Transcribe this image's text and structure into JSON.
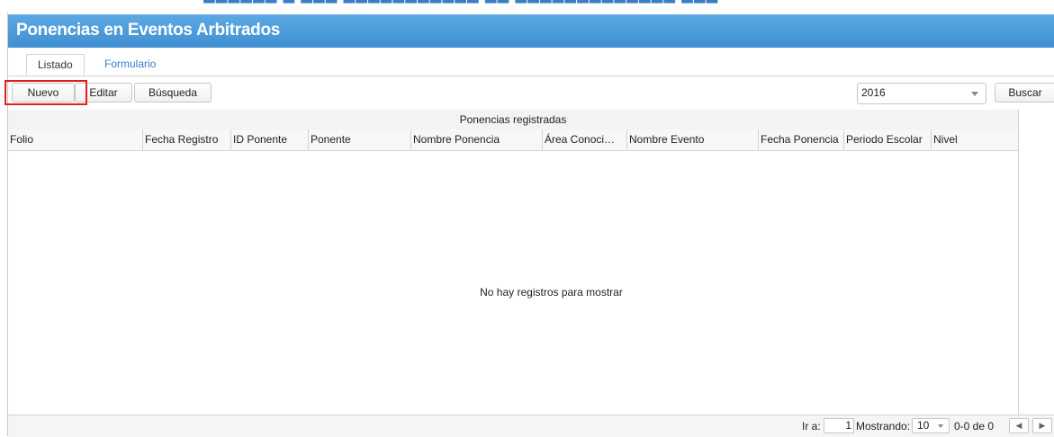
{
  "section": {
    "title": "Ponencias en Eventos Arbitrados"
  },
  "tabs": [
    {
      "label": "Listado",
      "active": true
    },
    {
      "label": "Formulario",
      "active": false
    }
  ],
  "toolbar": {
    "nuevo_label": "Nuevo",
    "editar_label": "Editar",
    "busqueda_label": "Búsqueda",
    "year_select_value": "2016",
    "buscar_label": "Buscar"
  },
  "grid": {
    "caption": "Ponencias registradas",
    "columns": [
      "Folio",
      "Fecha Registro",
      "ID Ponente",
      "Ponente",
      "Nombre Ponencia",
      "Área Conoci…",
      "Nombre Evento",
      "Fecha Ponencia",
      "Periodo Escolar",
      "Nivel"
    ],
    "empty_message": "No hay registros para mostrar"
  },
  "pager": {
    "goto_label": "Ir a:",
    "page_value": "1",
    "showing_label": "Mostrando:",
    "page_size": "10",
    "range_text": "0-0 de 0"
  },
  "colors": {
    "title_bar": "#4a9ad9",
    "link": "#2f7fc9",
    "highlight": "#e0201e"
  }
}
